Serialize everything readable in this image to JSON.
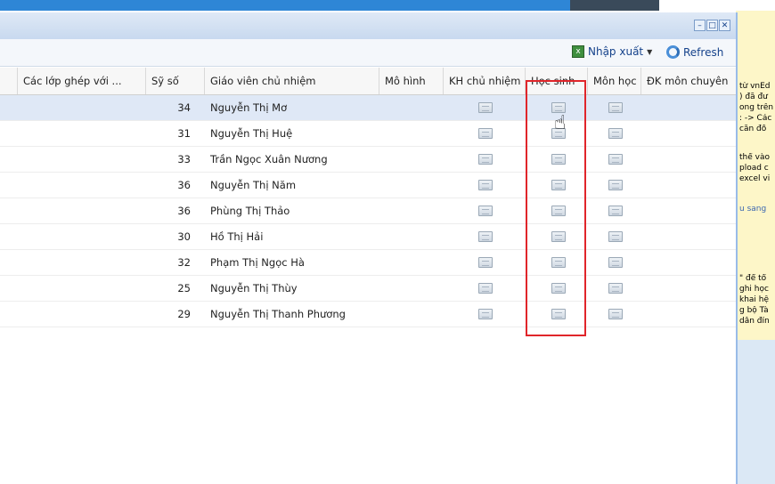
{
  "toolbar": {
    "export_label": "Nhập xuất",
    "refresh_label": "Refresh"
  },
  "window_buttons": [
    "–",
    "□",
    "✕"
  ],
  "columns": {
    "ghep": "Các lớp ghép với ...",
    "siso": "Sỹ số",
    "gvcn": "Giáo viên chủ nhiệm",
    "mohinh": "Mô hình",
    "khcn": "KH chủ nhiệm",
    "hocsinh": "Học sinh",
    "monhoc": "Môn học",
    "dkmon": "ĐK môn chuyên"
  },
  "rows": [
    {
      "siso": "34",
      "gvcn": "Nguyễn Thị Mơ"
    },
    {
      "siso": "31",
      "gvcn": "Nguyễn Thị Huệ"
    },
    {
      "siso": "33",
      "gvcn": "Trần Ngọc Xuân Nương"
    },
    {
      "siso": "36",
      "gvcn": "Nguyễn Thị Năm"
    },
    {
      "siso": "36",
      "gvcn": "Phùng Thị Thảo"
    },
    {
      "siso": "30",
      "gvcn": "Hồ Thị Hải"
    },
    {
      "siso": "32",
      "gvcn": "Phạm Thị Ngọc Hà"
    },
    {
      "siso": "25",
      "gvcn": "Nguyễn Thị Thùy"
    },
    {
      "siso": "29",
      "gvcn": "Nguyễn Thị Thanh Phương"
    }
  ],
  "background_text": {
    "l1": "từ vnEd",
    "l2": ") đã đư",
    "l3": "ong trên",
    "l4": ": -> Các",
    "l5": "căn đồ",
    "l6": "thể vào",
    "l7": "pload c",
    "l8": "excel vi",
    "l9": "u sang",
    "l10": "\" để tổ",
    "l11": "ghi học",
    "l12": "khai hệ",
    "l13": "g bộ Tà",
    "l14": "dẫn đín"
  },
  "colors": {
    "highlight": "#e0252a",
    "header_blue": "#15428b",
    "selected_row": "#dfe8f6"
  }
}
